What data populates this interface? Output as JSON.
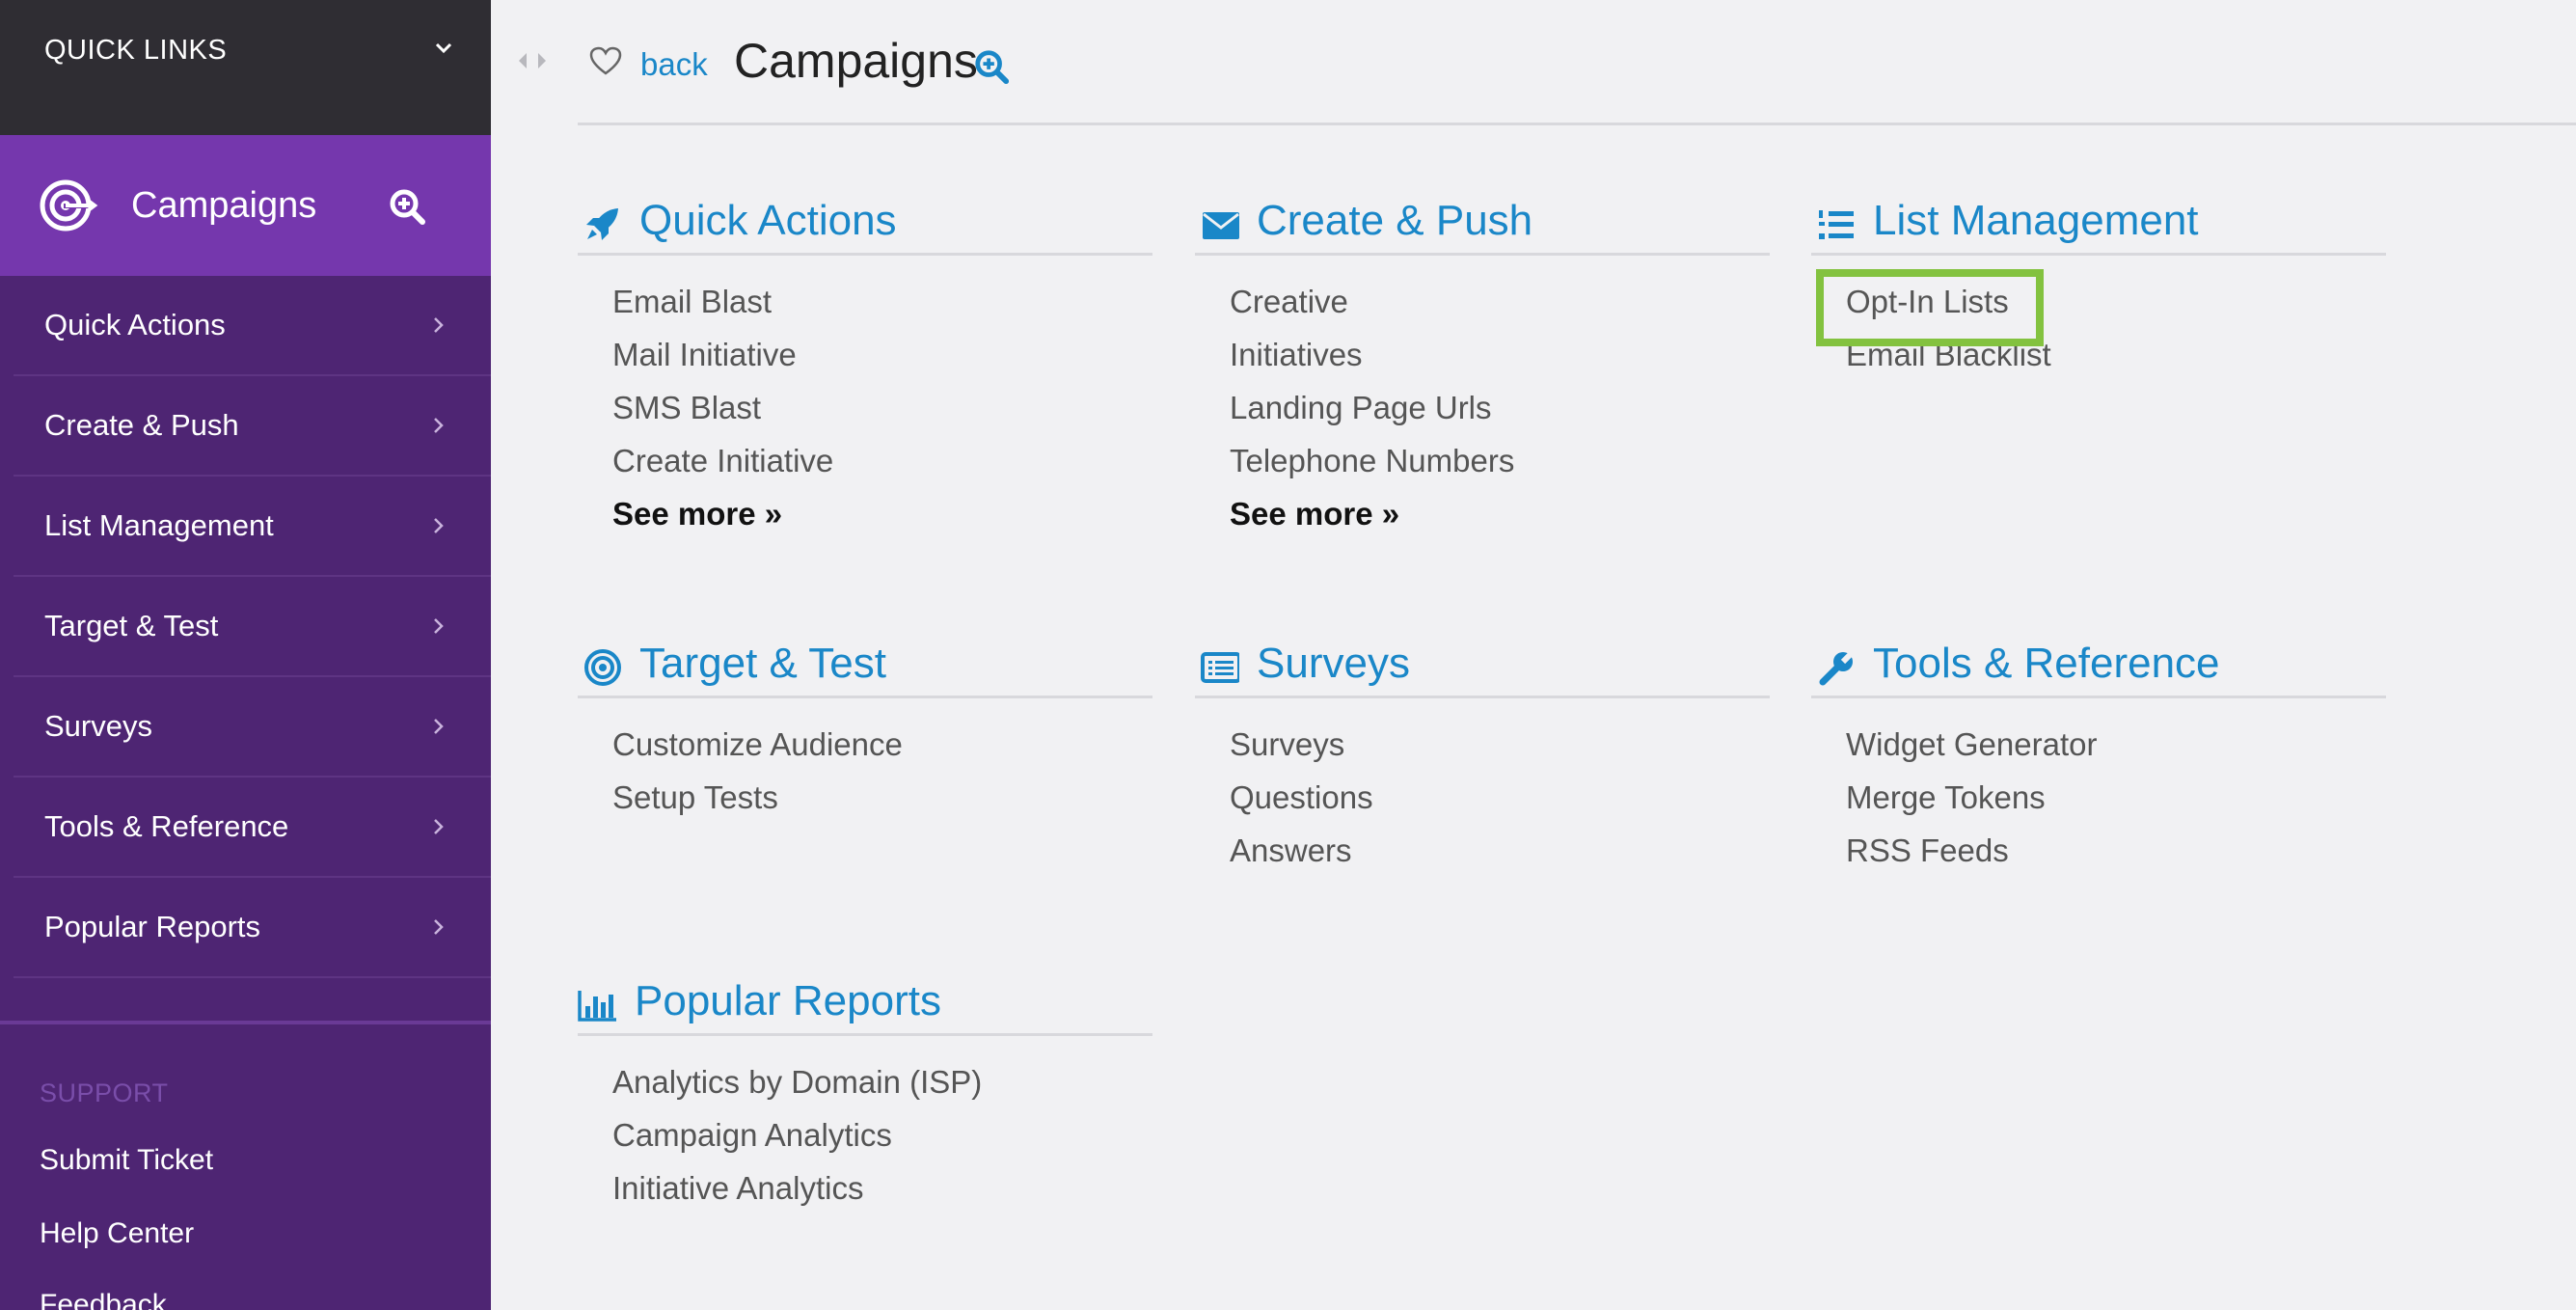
{
  "quick_links": {
    "label": "QUICK LINKS"
  },
  "sidebar": {
    "section_title": "Campaigns",
    "items": [
      {
        "label": "Quick Actions"
      },
      {
        "label": "Create & Push"
      },
      {
        "label": "List Management"
      },
      {
        "label": "Target & Test"
      },
      {
        "label": "Surveys"
      },
      {
        "label": "Tools & Reference"
      },
      {
        "label": "Popular Reports"
      }
    ],
    "support": {
      "heading": "SUPPORT",
      "links": [
        "Submit Ticket",
        "Help Center",
        "Feedback"
      ]
    }
  },
  "header": {
    "back_label": "back",
    "title": "Campaigns"
  },
  "colors": {
    "sidebar_bg": "#4e2573",
    "sidebar_section_bg": "#7537ad",
    "quick_links_bg": "#2f2d33",
    "accent_blue": "#1a87c8",
    "highlight_green": "#83c23f"
  },
  "cards": [
    {
      "icon": "rocket-icon",
      "title": "Quick Actions",
      "links": [
        "Email Blast",
        "Mail Initiative",
        "SMS Blast",
        "Create Initiative"
      ],
      "more": "See more »"
    },
    {
      "icon": "envelope-icon",
      "title": "Create & Push",
      "links": [
        "Creative",
        "Initiatives",
        "Landing Page Urls",
        "Telephone Numbers"
      ],
      "more": "See more »"
    },
    {
      "icon": "numbered-list-icon",
      "title": "List Management",
      "links": [
        "Opt-In Lists",
        "Email Blacklist"
      ]
    },
    {
      "icon": "target-icon",
      "title": "Target & Test",
      "links": [
        "Customize Audience",
        "Setup Tests"
      ]
    },
    {
      "icon": "survey-list-icon",
      "title": "Surveys",
      "links": [
        "Surveys",
        "Questions",
        "Answers"
      ]
    },
    {
      "icon": "wrench-icon",
      "title": "Tools & Reference",
      "links": [
        "Widget Generator",
        "Merge Tokens",
        "RSS Feeds"
      ]
    },
    {
      "icon": "bar-chart-icon",
      "title": "Popular Reports",
      "links": [
        "Analytics by Domain (ISP)",
        "Campaign Analytics",
        "Initiative Analytics"
      ]
    }
  ]
}
